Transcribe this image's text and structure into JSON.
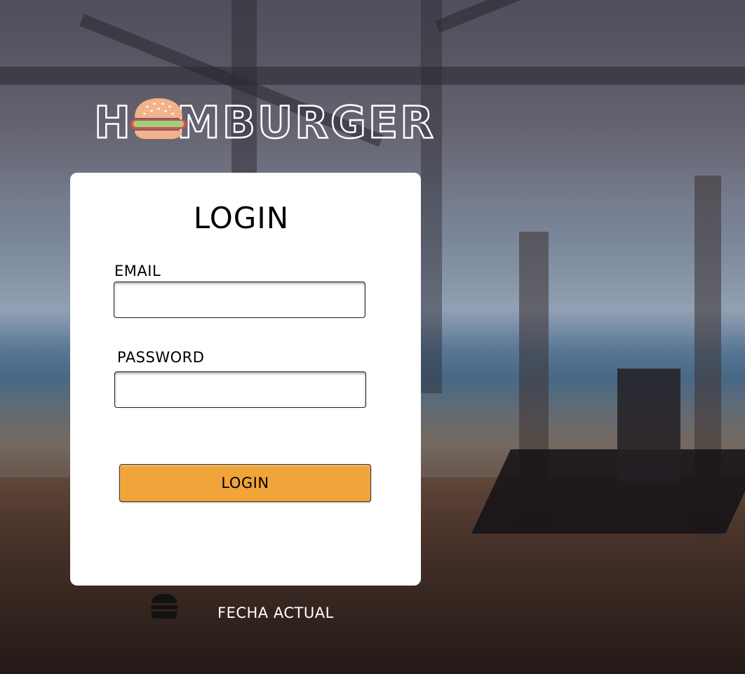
{
  "brand": {
    "logo_text": "HAMBURGER",
    "logo_icon": "hamburger-icon"
  },
  "login": {
    "title": "LOGIN",
    "email_label": "EMAIL",
    "email_value": "",
    "password_label": "PASSWORD",
    "password_value": "",
    "submit_label": "LOGIN"
  },
  "footer": {
    "icon": "hamburger-icon",
    "date_label": "FECHA ACTUAL"
  },
  "colors": {
    "button": "#f0a43a",
    "card": "#ffffff",
    "footer_text": "#ffffff"
  }
}
